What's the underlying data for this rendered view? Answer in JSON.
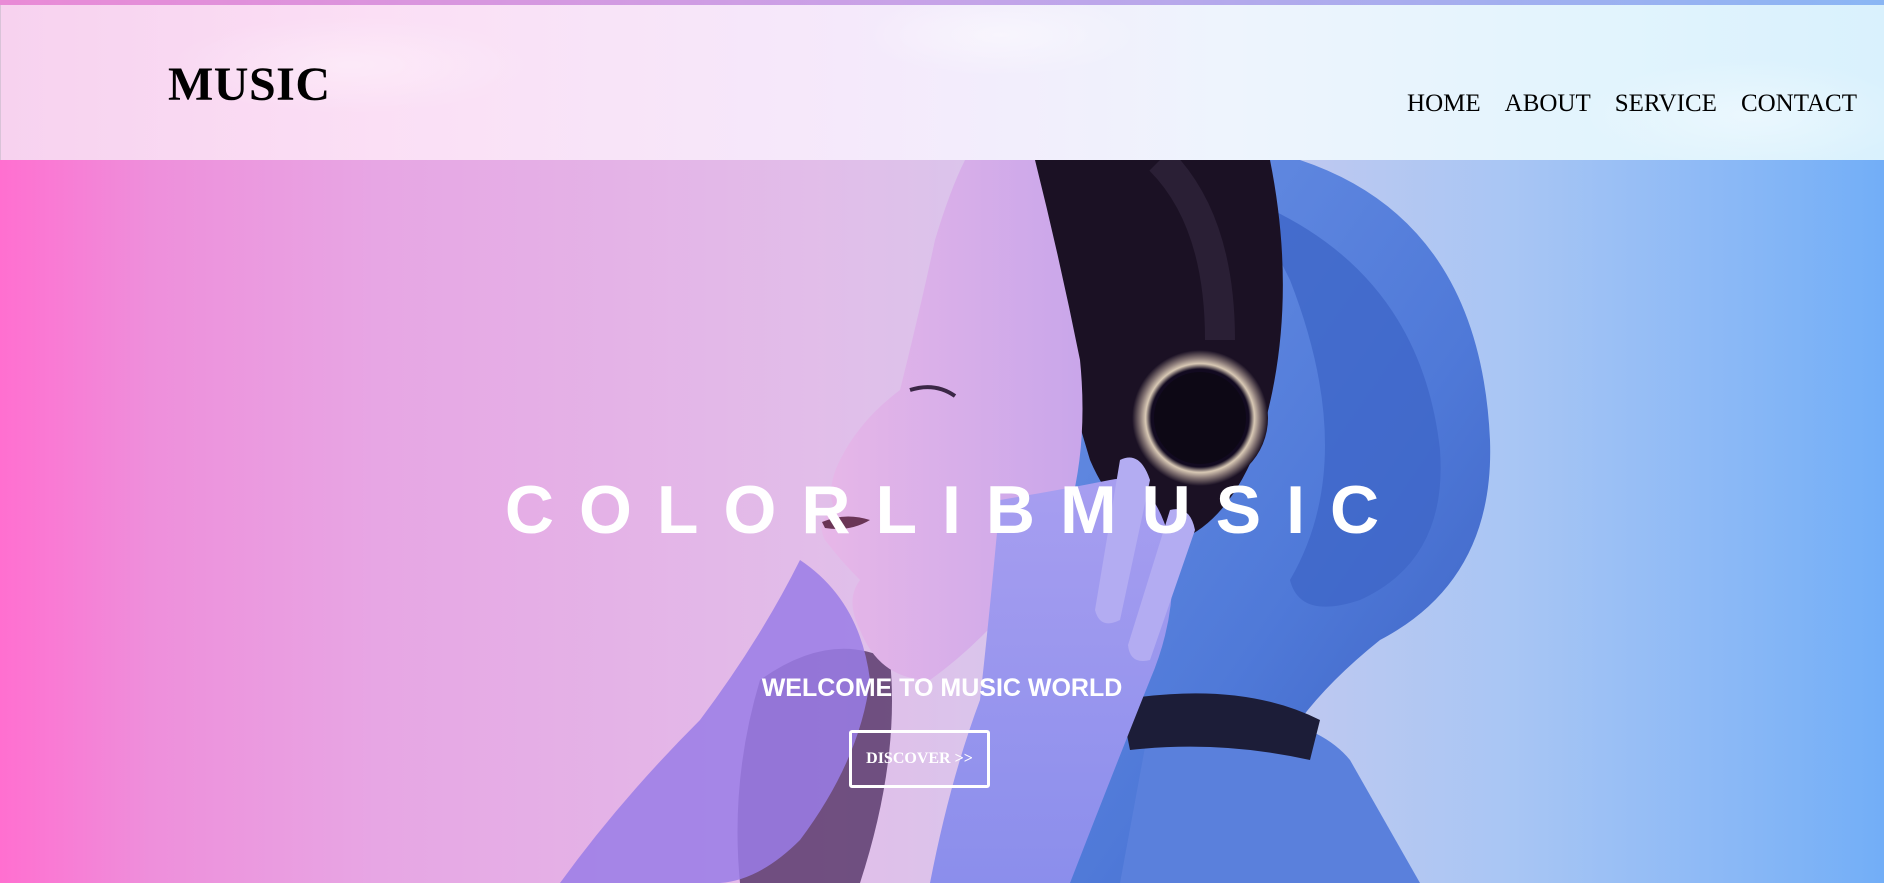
{
  "header": {
    "logo": "MUSIC",
    "nav": [
      "HOME",
      "ABOUT",
      "SERVICE",
      "CONTACT"
    ]
  },
  "hero": {
    "title": "COLORLIBMUSIC",
    "subtitle": "WELCOME TO MUSIC WORLD",
    "cta_label": "DISCOVER >>"
  },
  "colors": {
    "gradient_left": "#ff6fd0",
    "gradient_right": "#72aef7",
    "text": "#ffffff",
    "nav_text": "#000000"
  }
}
